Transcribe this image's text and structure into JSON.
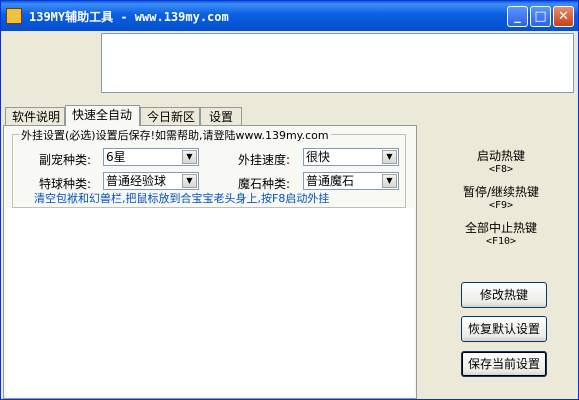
{
  "window": {
    "title": "139MY辅助工具 - www.139my.com",
    "min_icon": "minimize-icon",
    "max_icon": "maximize-icon",
    "close_icon": "close-icon"
  },
  "tabs": [
    {
      "label": "软件说明"
    },
    {
      "label": "快速全自动"
    },
    {
      "label": "今日新区"
    },
    {
      "label": "设置"
    }
  ],
  "settings": {
    "legend": "外挂设置(必选)设置后保存!如需帮助,请登陆www.139my.com",
    "pet_type_label": "副宠种类:",
    "pet_type_value": "6星",
    "speed_label": "外挂速度:",
    "speed_value": "很快",
    "ball_type_label": "特球种类:",
    "ball_type_value": "普通经验球",
    "stone_type_label": "魔石种类:",
    "stone_type_value": "普通魔石",
    "hint": "清空包袱和幻兽栏,把鼠标放到合宝宝老头身上,按F8启动外挂"
  },
  "hotkeys": {
    "start_label": "启动热键",
    "start_key": "<F8>",
    "pause_label": "暂停/继续热键",
    "pause_key": "<F9>",
    "stop_label": "全部中止热键",
    "stop_key": "<F10>"
  },
  "buttons": {
    "modify": "修改热键",
    "restore": "恢复默认设置",
    "save": "保存当前设置"
  },
  "colors": {
    "titlebar": "#0a5fe0",
    "hint_text": "#0050c0"
  }
}
